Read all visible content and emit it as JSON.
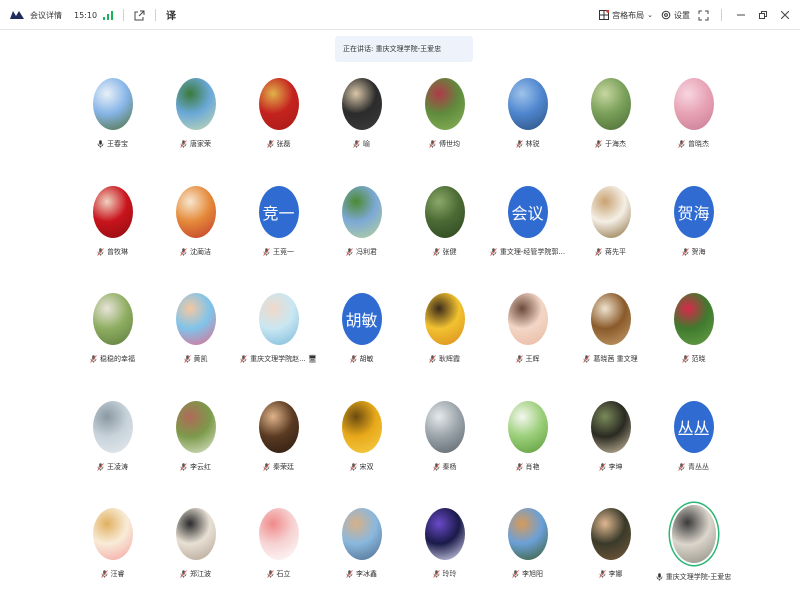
{
  "titlebar": {
    "meeting_details": "会议详情",
    "time": "15:10",
    "layout_label": "宫格布局",
    "settings_label": "设置"
  },
  "speaking_banner": "正在讲话: 重庆文理学院-王爱忠",
  "colors": {
    "accent_blue": "#2f6bd1",
    "muted_mic": "#e05a4e",
    "active_green": "#2bb673",
    "signal_green": "#19b35a"
  },
  "participants": [
    {
      "name": "王春宝",
      "mic": "active",
      "avatar": "photo",
      "palette": [
        "#87b5e8",
        "#e9f1f8",
        "#4d6f35"
      ]
    },
    {
      "name": "唐家荣",
      "mic": "muted",
      "avatar": "photo",
      "palette": [
        "#6aa8d8",
        "#3b7a3a",
        "#c8d9b0"
      ]
    },
    {
      "name": "张磊",
      "mic": "muted",
      "avatar": "photo",
      "palette": [
        "#c4231f",
        "#e0b24a",
        "#a81b17"
      ]
    },
    {
      "name": "喻",
      "mic": "muted",
      "avatar": "photo",
      "palette": [
        "#2b2b2b",
        "#d9c7a8",
        "#3d3d3d"
      ]
    },
    {
      "name": "傅世均",
      "mic": "muted",
      "avatar": "photo",
      "palette": [
        "#5f8b3c",
        "#b03a4a",
        "#8cb35a"
      ]
    },
    {
      "name": "林锐",
      "mic": "muted",
      "avatar": "photo",
      "palette": [
        "#4f86cf",
        "#9fc3ea",
        "#2b4f7a"
      ]
    },
    {
      "name": "于海杰",
      "mic": "muted",
      "avatar": "photo",
      "palette": [
        "#7aa05a",
        "#c7d7a0",
        "#4b6b34"
      ]
    },
    {
      "name": "曾晓杰",
      "mic": "muted",
      "avatar": "photo",
      "palette": [
        "#e7a3b6",
        "#f7d6e0",
        "#c97a93"
      ]
    },
    {
      "name": "曾牧琳",
      "mic": "muted",
      "avatar": "photo",
      "palette": [
        "#c8141c",
        "#f0d2c0",
        "#8c0d12"
      ]
    },
    {
      "name": "沈蔺洁",
      "mic": "muted",
      "avatar": "photo",
      "palette": [
        "#e58a3a",
        "#f7e7cf",
        "#c0392b"
      ]
    },
    {
      "name": "王竞一",
      "mic": "muted",
      "avatar": "text",
      "text": "竞一"
    },
    {
      "name": "冯利君",
      "mic": "muted",
      "avatar": "photo",
      "palette": [
        "#7da9d6",
        "#4d8a32",
        "#b7d39a"
      ]
    },
    {
      "name": "张健",
      "mic": "muted",
      "avatar": "photo",
      "palette": [
        "#4a6a34",
        "#8aa868",
        "#2d4520"
      ]
    },
    {
      "name": "重文理-经管学院郭...",
      "mic": "muted",
      "avatar": "text",
      "text": "会议"
    },
    {
      "name": "蒋先平",
      "mic": "muted",
      "avatar": "photo",
      "palette": [
        "#f4efe6",
        "#c9a272",
        "#8a6a3a"
      ]
    },
    {
      "name": "贺海",
      "mic": "muted",
      "avatar": "text",
      "text": "贺海"
    },
    {
      "name": "稳稳的幸福",
      "mic": "muted",
      "avatar": "photo",
      "palette": [
        "#8fae62",
        "#e9e3da",
        "#5c7a3c"
      ]
    },
    {
      "name": "黄凯",
      "mic": "muted",
      "avatar": "photo",
      "palette": [
        "#7fc4ea",
        "#f4c7a2",
        "#e56a8c"
      ]
    },
    {
      "name": "重庆文理学院赵... 🖥",
      "mic": "muted",
      "avatar": "photo",
      "palette": [
        "#c9e7f2",
        "#f0d8c8",
        "#7ab8d9"
      ]
    },
    {
      "name": "胡敏",
      "mic": "muted",
      "avatar": "text",
      "text": "胡敏"
    },
    {
      "name": "耿辉霞",
      "mic": "muted",
      "avatar": "photo",
      "palette": [
        "#f2c230",
        "#3a2a1a",
        "#d98a1e"
      ]
    },
    {
      "name": "王辉",
      "mic": "muted",
      "avatar": "photo",
      "palette": [
        "#f3d6c6",
        "#6b4a3a",
        "#e8b8a0"
      ]
    },
    {
      "name": "葛晓茜 重文理",
      "mic": "muted",
      "avatar": "photo",
      "palette": [
        "#8a5a2a",
        "#efe3cf",
        "#c8a070"
      ]
    },
    {
      "name": "范晓",
      "mic": "muted",
      "avatar": "photo",
      "palette": [
        "#3f7a2e",
        "#d8284a",
        "#6aa048"
      ]
    },
    {
      "name": "王凌涛",
      "mic": "muted",
      "avatar": "photo",
      "palette": [
        "#c7d2da",
        "#8a98a2",
        "#e8ecef"
      ]
    },
    {
      "name": "李云红",
      "mic": "muted",
      "avatar": "photo",
      "palette": [
        "#7c9a4a",
        "#b06a5a",
        "#dfe8d0"
      ]
    },
    {
      "name": "秦荣廷",
      "mic": "muted",
      "avatar": "photo",
      "palette": [
        "#5a3a22",
        "#e0b48a",
        "#2a1a10"
      ]
    },
    {
      "name": "宋双",
      "mic": "muted",
      "avatar": "photo",
      "palette": [
        "#e8a91a",
        "#6a4a10",
        "#f6cf4a"
      ]
    },
    {
      "name": "秦杨",
      "mic": "muted",
      "avatar": "photo",
      "palette": [
        "#9aa4aa",
        "#e6e9eb",
        "#5a6268"
      ]
    },
    {
      "name": "肖艳",
      "mic": "muted",
      "avatar": "photo",
      "palette": [
        "#9ccf7a",
        "#f4f7ef",
        "#5a9a3a"
      ]
    },
    {
      "name": "李坤",
      "mic": "muted",
      "avatar": "photo",
      "palette": [
        "#2a2a22",
        "#7a8a5a",
        "#d8c8a8"
      ]
    },
    {
      "name": "青丛丛",
      "mic": "muted",
      "avatar": "text",
      "text": "丛丛"
    },
    {
      "name": "汪睿",
      "mic": "muted",
      "avatar": "photo",
      "palette": [
        "#f8ecd8",
        "#e0b060",
        "#f4a0a0"
      ]
    },
    {
      "name": "郑江波",
      "mic": "muted",
      "avatar": "photo",
      "palette": [
        "#e8e0d4",
        "#2a2a2a",
        "#b0a090"
      ]
    },
    {
      "name": "石立",
      "mic": "muted",
      "avatar": "photo",
      "palette": [
        "#f6d2d2",
        "#f08a8a",
        "#ffffff"
      ]
    },
    {
      "name": "李冰鑫",
      "mic": "muted",
      "avatar": "photo",
      "palette": [
        "#8ab8de",
        "#d8b088",
        "#4a6a8a"
      ]
    },
    {
      "name": "玲玲",
      "mic": "muted",
      "avatar": "photo",
      "palette": [
        "#1a1a4a",
        "#6a4ac8",
        "#e8e8ff"
      ]
    },
    {
      "name": "李旭阳",
      "mic": "muted",
      "avatar": "photo",
      "palette": [
        "#6aa0d8",
        "#d89a5a",
        "#3a5a2a"
      ]
    },
    {
      "name": "李娜",
      "mic": "muted",
      "avatar": "photo",
      "palette": [
        "#3a3a2a",
        "#e0b890",
        "#7a5a3a"
      ]
    },
    {
      "name": "重庆文理学院-王爱忠",
      "mic": "active",
      "avatar": "photo",
      "palette": [
        "#dcd6cc",
        "#3a3a3a",
        "#8a8a80"
      ],
      "speaking": true
    }
  ]
}
